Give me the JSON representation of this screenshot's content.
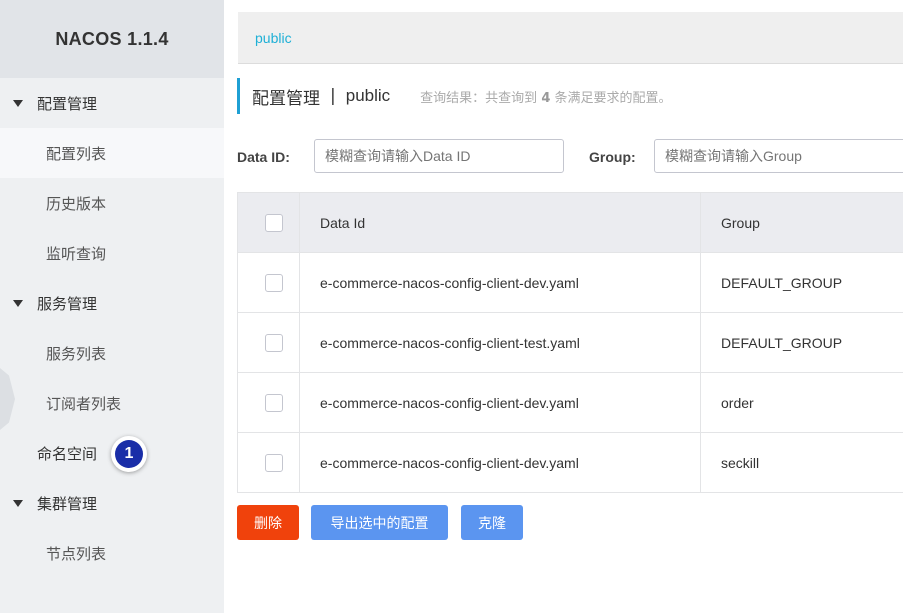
{
  "app": {
    "title": "NACOS 1.1.4"
  },
  "sidebar": {
    "groups": [
      {
        "label": "配置管理",
        "items": [
          "配置列表",
          "历史版本",
          "监听查询"
        ]
      },
      {
        "label": "服务管理",
        "items": [
          "服务列表",
          "订阅者列表"
        ]
      },
      {
        "label": "命名空间"
      },
      {
        "label": "集群管理",
        "items": [
          "节点列表"
        ]
      }
    ],
    "badge": "1"
  },
  "namespace_bar": {
    "current": "public"
  },
  "page": {
    "title": "配置管理",
    "separator": "|",
    "namespace": "public",
    "hint_prefix": "查询结果：共查询到",
    "hint_count": "4",
    "hint_suffix": "条满足要求的配置。"
  },
  "search": {
    "data_id_label": "Data ID:",
    "data_id_placeholder": "模糊查询请输入Data ID",
    "group_label": "Group:",
    "group_placeholder": "模糊查询请输入Group"
  },
  "table": {
    "headers": {
      "data_id": "Data Id",
      "group": "Group"
    },
    "rows": [
      {
        "data_id": "e-commerce-nacos-config-client-dev.yaml",
        "group": "DEFAULT_GROUP"
      },
      {
        "data_id": "e-commerce-nacos-config-client-test.yaml",
        "group": "DEFAULT_GROUP"
      },
      {
        "data_id": "e-commerce-nacos-config-client-dev.yaml",
        "group": "order"
      },
      {
        "data_id": "e-commerce-nacos-config-client-dev.yaml",
        "group": "seckill"
      }
    ]
  },
  "actions": {
    "delete": "删除",
    "export": "导出选中的配置",
    "clone": "克隆"
  },
  "colors": {
    "accent": "#1fb0d6",
    "danger": "#f0420c",
    "primary": "#5b95f0",
    "badge": "#1a2ea8"
  }
}
